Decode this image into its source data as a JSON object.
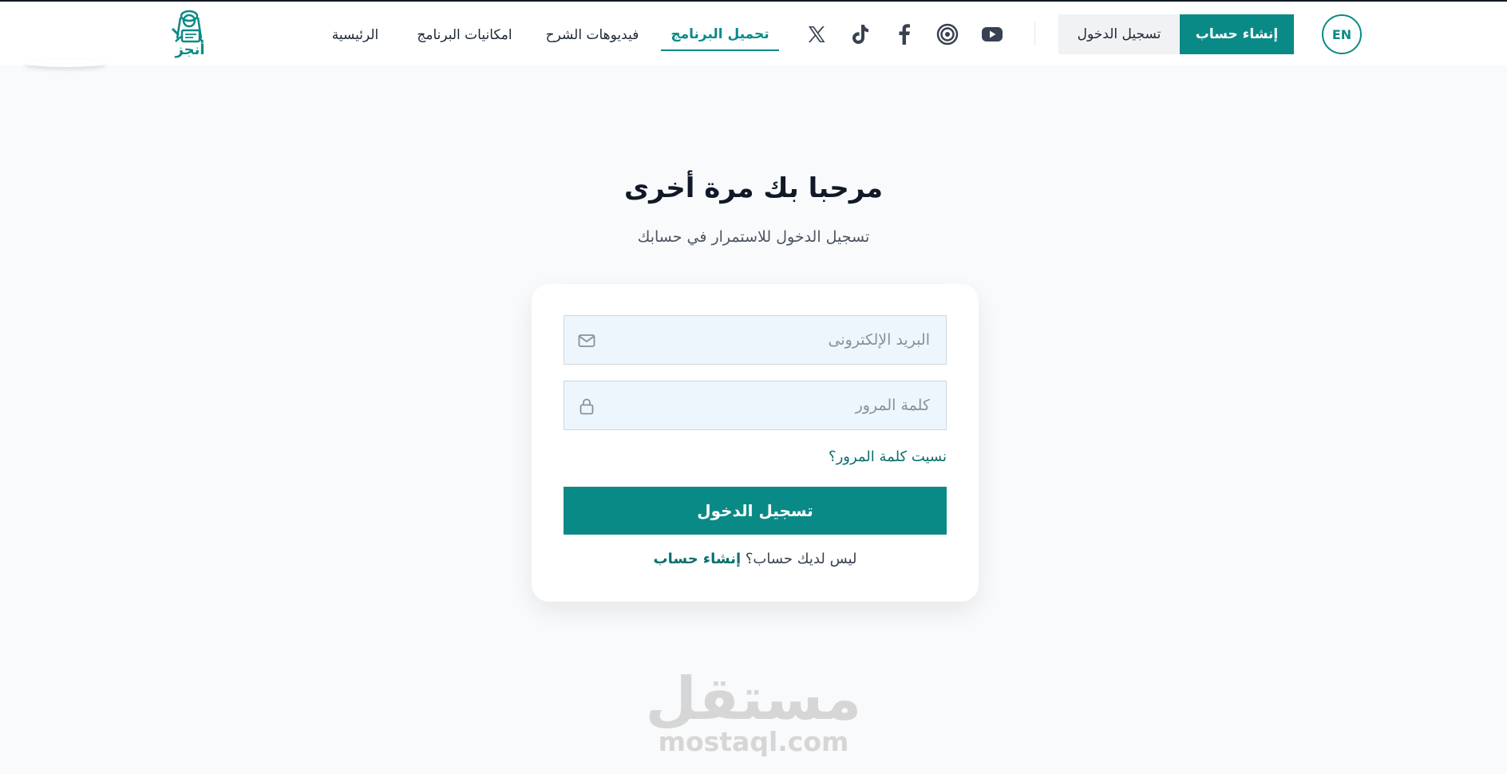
{
  "header": {
    "lang_button": "EN",
    "signup_button": "إنشاء حساب",
    "login_button": "تسجيل الدخول",
    "logo_text": "أنجز",
    "social_icons": [
      "youtube-icon",
      "threads-icon",
      "facebook-icon",
      "tiktok-icon",
      "x-icon"
    ],
    "nav": [
      {
        "label": "تحميل البرنامج",
        "active": true
      },
      {
        "label": "فيديوهات الشرح",
        "active": false
      },
      {
        "label": "امكانيات البرنامج",
        "active": false
      },
      {
        "label": "الرئيسية",
        "active": false
      }
    ]
  },
  "main": {
    "title": "مرحبا بك مرة أخرى",
    "subtitle": "تسجيل الدخول للاستمرار في حسابك",
    "email_placeholder": "البريد الإلكترونى",
    "password_placeholder": "كلمة المرور",
    "forgot_link": "نسيت كلمة المرور؟",
    "submit_button": "تسجيل الدخول",
    "no_account_text": "ليس لديك حساب؟",
    "signup_link": "إنشاء حساب"
  },
  "watermark": {
    "arabic": "مستقل",
    "latin": "mostaql.com"
  },
  "colors": {
    "accent": "#0a8a87",
    "background": "#f9fafb",
    "field_background": "#eef6fd"
  }
}
